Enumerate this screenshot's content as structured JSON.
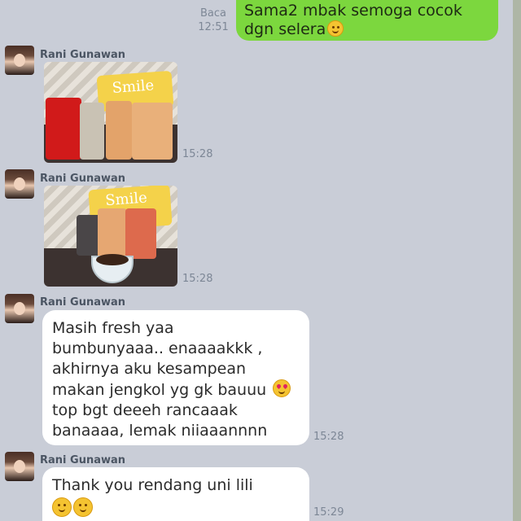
{
  "outgoing": {
    "status": "Baca",
    "time": "12:51",
    "line1": "Sama2 mbak semoga cocok",
    "line2": "dgn selera",
    "emoji": "smiling-face-icon"
  },
  "messages": [
    {
      "sender": "Rani Gunawan",
      "type": "photo",
      "time": "15:28",
      "photo_text": "Smile"
    },
    {
      "sender": "Rani Gunawan",
      "type": "photo",
      "time": "15:28",
      "photo_text": "Smile"
    },
    {
      "sender": "Rani Gunawan",
      "type": "text",
      "time": "15:28",
      "lines": [
        "Masih fresh yaa",
        "bumbunyaaa.. enaaaakkk ,",
        "akhirnya aku kesampean",
        "makan jengkol yg gk bauuu",
        "top bgt deeeh rancaaak",
        "banaaaa, lemak niiaaannnn"
      ],
      "emoji": "heart-eyes-icon"
    },
    {
      "sender": "Rani Gunawan",
      "type": "text",
      "time": "15:29",
      "lines": [
        "Thank you rendang uni lili"
      ],
      "emoji": "smiling-face-icon"
    }
  ],
  "colors": {
    "background": "#c9cdd7",
    "outgoing_bubble": "#7cd73e",
    "incoming_bubble": "#ffffff"
  }
}
